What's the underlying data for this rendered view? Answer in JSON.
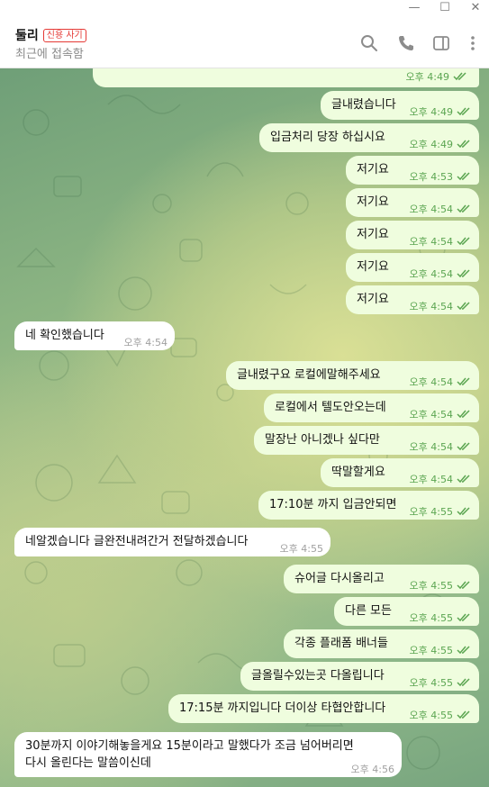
{
  "window": {
    "minimize": "—",
    "maximize": "☐",
    "close": "✕"
  },
  "header": {
    "name": "둘리",
    "badge": "신용 사기",
    "status": "최근에 접속함"
  },
  "icons": {
    "search": "search-icon",
    "call": "phone-icon",
    "sidebar": "sidebar-toggle-icon",
    "more": "more-vertical-icon"
  },
  "top_partial": {
    "time": "오후 4:49"
  },
  "messages": [
    {
      "dir": "out",
      "text": "글내렸습니다",
      "time": "오후 4:49"
    },
    {
      "dir": "out",
      "text": "입금처리 당장 하십시요",
      "time": "오후 4:49"
    },
    {
      "dir": "out",
      "text": "저기요",
      "time": "오후 4:53"
    },
    {
      "dir": "out",
      "text": "저기요",
      "time": "오후 4:54"
    },
    {
      "dir": "out",
      "text": "저기요",
      "time": "오후 4:54"
    },
    {
      "dir": "out",
      "text": "저기요",
      "time": "오후 4:54"
    },
    {
      "dir": "out",
      "text": "저기요",
      "time": "오후 4:54"
    },
    {
      "dir": "in",
      "text": "네 확인했습니다",
      "time": "오후 4:54"
    },
    {
      "dir": "out",
      "text": "글내렸구요 로컬에말해주세요",
      "time": "오후 4:54"
    },
    {
      "dir": "out",
      "text": "로컬에서 텔도안오는데",
      "time": "오후 4:54"
    },
    {
      "dir": "out",
      "text": "말장난 아니겠나 싶다만",
      "time": "오후 4:54"
    },
    {
      "dir": "out",
      "text": "딱말할게요",
      "time": "오후 4:54"
    },
    {
      "dir": "out",
      "text": "17:10분 까지 입금안되면",
      "time": "오후 4:55"
    },
    {
      "dir": "in",
      "text": "네알겠습니다 글완전내려간거 전달하겠습니다",
      "time": "오후 4:55"
    },
    {
      "dir": "out",
      "text": "슈어글 다시올리고",
      "time": "오후 4:55"
    },
    {
      "dir": "out",
      "text": "다른 모든",
      "time": "오후 4:55"
    },
    {
      "dir": "out",
      "text": "각종 플래폼 배너들",
      "time": "오후 4:55"
    },
    {
      "dir": "out",
      "text": "글올릴수있는곳 다올립니다",
      "time": "오후 4:55"
    },
    {
      "dir": "out",
      "text": "17:15분 까지입니다 더이상 타협안합니다",
      "time": "오후 4:55"
    },
    {
      "dir": "in",
      "text": "30분까지 이야기해놓을게요 15분이라고 말했다가 조금 넘어버리면",
      "text2": "다시 올린다는 말씀이신데",
      "time": "오후 4:56"
    }
  ]
}
